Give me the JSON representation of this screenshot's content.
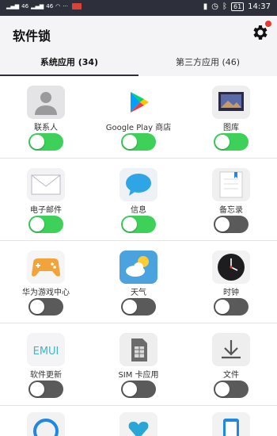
{
  "status_bar": {
    "signal_1": "46",
    "signal_2": "46",
    "battery": "61",
    "time": "14:37"
  },
  "app": {
    "title": "软件锁"
  },
  "tabs": [
    {
      "label": "系统应用 (34)",
      "active": true
    },
    {
      "label": "第三方应用 (46)",
      "active": false
    }
  ],
  "apps": [
    {
      "label": "联系人",
      "icon": "contacts-icon",
      "locked": true
    },
    {
      "label": "Google Play 商店",
      "icon": "google-play-icon",
      "locked": true
    },
    {
      "label": "图库",
      "icon": "gallery-icon",
      "locked": true
    },
    {
      "label": "电子邮件",
      "icon": "email-icon",
      "locked": true
    },
    {
      "label": "信息",
      "icon": "messages-icon",
      "locked": true
    },
    {
      "label": "备忘录",
      "icon": "notepad-icon",
      "locked": false
    },
    {
      "label": "华为游戏中心",
      "icon": "game-center-icon",
      "locked": false
    },
    {
      "label": "天气",
      "icon": "weather-icon",
      "locked": false
    },
    {
      "label": "时钟",
      "icon": "clock-icon",
      "locked": false
    },
    {
      "label": "软件更新",
      "icon": "software-update-icon",
      "locked": false
    },
    {
      "label": "SIM 卡应用",
      "icon": "sim-card-icon",
      "locked": false
    },
    {
      "label": "文件",
      "icon": "files-icon",
      "locked": false
    }
  ],
  "colors": {
    "toggle_on": "#3dd15a",
    "toggle_off": "#5a5a5a",
    "status_bar": "#2d2f3a"
  }
}
